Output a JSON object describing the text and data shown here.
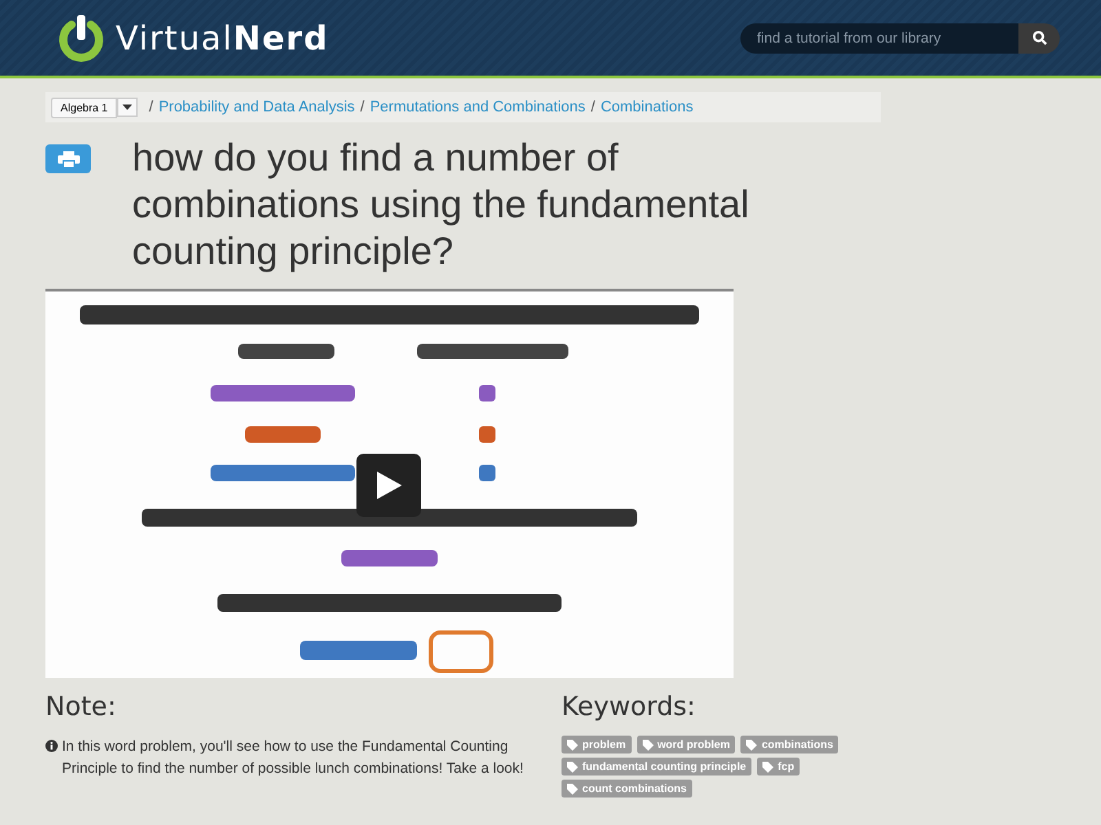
{
  "header": {
    "logo": "Virtual**Nerd**",
    "search": {
      "placeholder": "find a tutorial from our library"
    }
  },
  "breadcrumb": {
    "course": "Algebra 1",
    "links": [
      "Probability and Data Analysis",
      "Permutations and Combinations",
      "Combinations"
    ],
    "separator": "/"
  },
  "title": "how do you find a number of combinations using the fundamental counting principle?",
  "note": {
    "heading": "Note:",
    "text": "In this word problem, you'll see how to use the Fundamental Counting Principle to find the number of possible lunch combinations! Take a look!"
  },
  "keywords": {
    "heading": "Keywords:",
    "tags": [
      "problem",
      "word problem",
      "combinations",
      "fundamental counting principle",
      "fcp",
      "count combinations"
    ]
  }
}
